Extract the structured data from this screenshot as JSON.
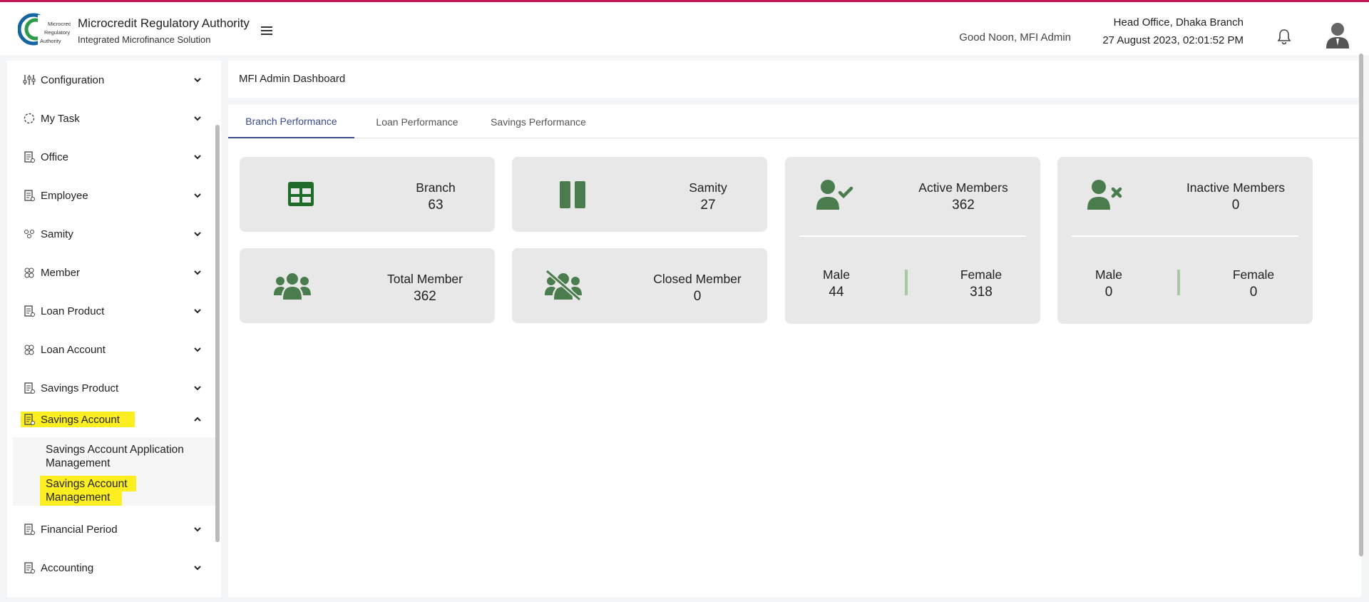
{
  "header": {
    "org_title": "Microcredit Regulatory Authority",
    "org_subtitle": "Integrated Microfinance Solution",
    "logo_text_line1": "Microcredit",
    "logo_text_line2": "Regulatory",
    "logo_text_line3": "Authority",
    "greeting": "Good Noon, MFI Admin",
    "branch": "Head Office, Dhaka Branch",
    "datetime": "27 August 2023, 02:01:52 PM"
  },
  "sidebar": {
    "items": [
      {
        "label": "Configuration",
        "icon": "sliders-icon",
        "expanded": false
      },
      {
        "label": "My Task",
        "icon": "task-circle-icon",
        "expanded": false
      },
      {
        "label": "Office",
        "icon": "document-icon",
        "expanded": false
      },
      {
        "label": "Employee",
        "icon": "document-icon",
        "expanded": false
      },
      {
        "label": "Samity",
        "icon": "group-icon",
        "expanded": false
      },
      {
        "label": "Member",
        "icon": "members-icon",
        "expanded": false
      },
      {
        "label": "Loan Product",
        "icon": "document-icon",
        "expanded": false
      },
      {
        "label": "Loan Account",
        "icon": "members-icon",
        "expanded": false
      },
      {
        "label": "Savings Product",
        "icon": "document-icon",
        "expanded": false
      },
      {
        "label": "Savings Account",
        "icon": "document-icon",
        "expanded": true,
        "highlighted": true
      },
      {
        "label": "Financial Period",
        "icon": "document-icon",
        "expanded": false
      },
      {
        "label": "Accounting",
        "icon": "document-icon",
        "expanded": false
      }
    ],
    "savings_account_submenu": [
      {
        "label_line1": "Savings Account Application",
        "label_line2": "Management",
        "highlighted": false
      },
      {
        "label_line1": "Savings Account",
        "label_line2": "Management",
        "highlighted": true
      }
    ]
  },
  "main": {
    "page_title": "MFI Admin Dashboard",
    "tabs": [
      {
        "label": "Branch Performance",
        "active": true
      },
      {
        "label": "Loan Performance",
        "active": false
      },
      {
        "label": "Savings Performance",
        "active": false
      }
    ],
    "cards": {
      "branch": {
        "label": "Branch",
        "value": "63",
        "icon": "table-grid-icon"
      },
      "samity": {
        "label": "Samity",
        "value": "27",
        "icon": "pause-bars-icon"
      },
      "total_member": {
        "label": "Total Member",
        "value": "362",
        "icon": "group-users-icon"
      },
      "closed_member": {
        "label": "Closed Member",
        "value": "0",
        "icon": "users-slash-icon"
      },
      "active_members": {
        "label": "Active Members",
        "value": "362",
        "icon": "user-check-icon",
        "male_label": "Male",
        "male_value": "44",
        "female_label": "Female",
        "female_value": "318"
      },
      "inactive_members": {
        "label": "Inactive Members",
        "value": "0",
        "icon": "user-x-icon",
        "male_label": "Male",
        "male_value": "0",
        "female_label": "Female",
        "female_value": "0"
      }
    }
  },
  "colors": {
    "accent": "#3a4a8c",
    "icon_green": "#4a7c4e",
    "highlight": "#fdee21",
    "card_bg": "#e7e8e7",
    "top_line": "#c2185b"
  }
}
